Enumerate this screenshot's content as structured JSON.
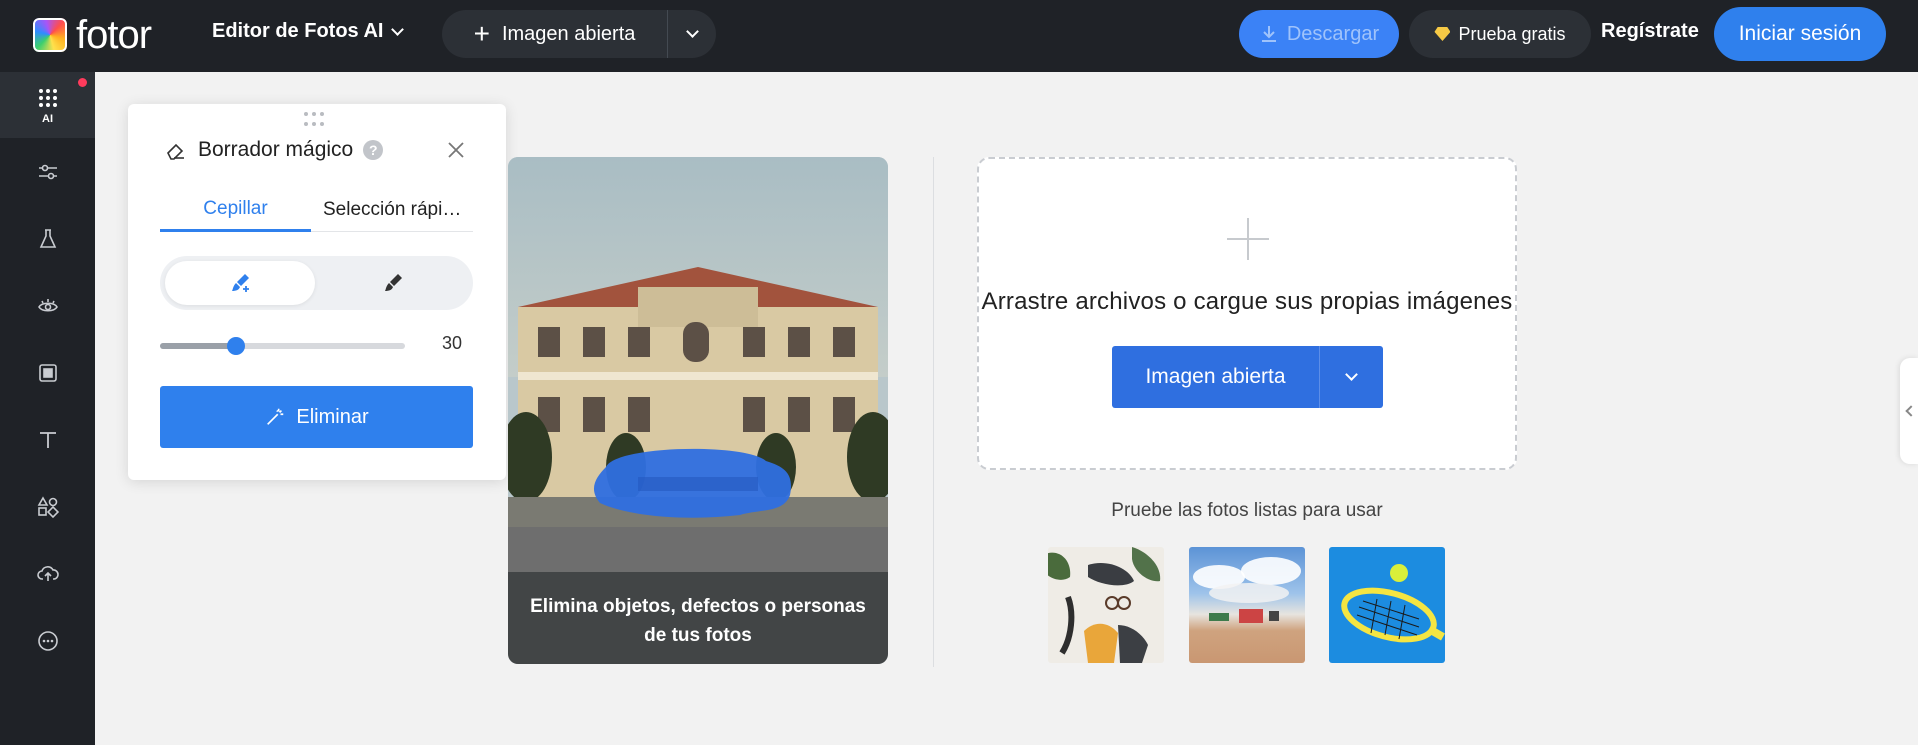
{
  "header": {
    "logo_text": "fotor",
    "editor_menu": "Editor de Fotos AI",
    "open_image": "Imagen abierta",
    "download": "Descargar",
    "trial": "Prueba gratis",
    "register": "Regístrate",
    "login": "Iniciar sesión"
  },
  "sidebar": {
    "items": [
      {
        "label": "AI",
        "icon": "grid-icon"
      },
      {
        "label": "",
        "icon": "adjust-icon"
      },
      {
        "label": "",
        "icon": "flask-icon"
      },
      {
        "label": "",
        "icon": "eye-icon"
      },
      {
        "label": "",
        "icon": "frame-icon"
      },
      {
        "label": "",
        "icon": "text-icon"
      },
      {
        "label": "",
        "icon": "elements-icon"
      },
      {
        "label": "",
        "icon": "cloud-upload-icon"
      },
      {
        "label": "",
        "icon": "more-icon"
      }
    ]
  },
  "panel": {
    "title": "Borrador mágico",
    "tabs": [
      "Cepillar",
      "Selección rápi…"
    ],
    "brush_size": "30",
    "brush_fraction": 0.31,
    "erase_button": "Eliminar"
  },
  "demo": {
    "caption": "Elimina objetos, defectos o personas de tus fotos"
  },
  "upload": {
    "prompt": "Arrastre archivos o cargue sus propias imágenes",
    "button": "Imagen abierta",
    "try_text": "Pruebe las fotos listas para usar"
  },
  "colors": {
    "accent": "#2f80ed",
    "topbar": "#1f2227",
    "highlight": "#2f6fe0"
  }
}
